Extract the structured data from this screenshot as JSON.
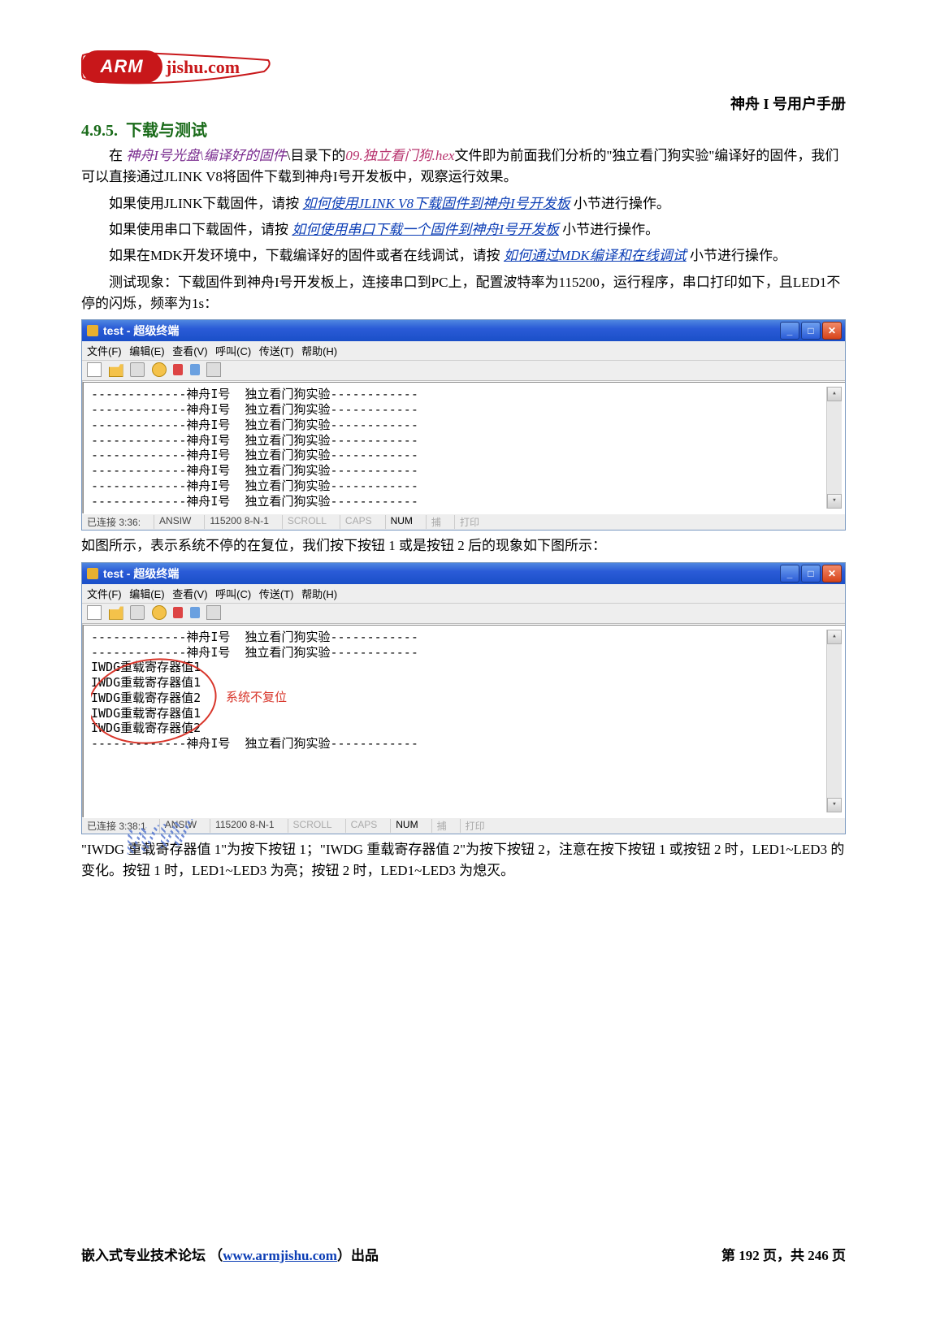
{
  "header": {
    "logo_red": "ARM",
    "logo_suffix": "jishu.com",
    "manual_title": "神舟 I 号用户手册"
  },
  "section": {
    "num": "4.9.5.",
    "title": "下载与测试"
  },
  "para": {
    "p1_a": "在 ",
    "p1_link1": "神舟I号光盘\\编译好的固件",
    "p1_b": "\\目录下的",
    "p1_link2": "09.独立看门狗.hex",
    "p1_c": "文件即为前面我们分析的\"独立看门狗实验\"编译好的固件，我们可以直接通过JLINK V8将固件下载到神舟I号开发板中，观察运行效果。",
    "p2_a": "如果使用JLINK下载固件，请按 ",
    "p2_link": "如何使用JLINK V8下载固件到神舟I号开发板",
    "p2_b": " 小节进行操作。",
    "p3_a": "如果使用串口下载固件，请按 ",
    "p3_link": "如何使用串口下载一个固件到神舟I号开发板",
    "p3_b": " 小节进行操作。",
    "p4_a": "如果在MDK开发环境中，下载编译好的固件或者在线调试，请按 ",
    "p4_link": "如何通过MDK编译和在线调试",
    "p4_b": " 小节进行操作。",
    "p5": "测试现象：下载固件到神舟I号开发板上，连接串口到PC上，配置波特率为115200，运行程序，串口打印如下，且LED1不停的闪烁，频率为1s：",
    "mid": "如图所示，表示系统不停的在复位，我们按下按钮 1 或是按钮 2 后的现象如下图所示：",
    "p6": "\"IWDG 重载寄存器值 1\"为按下按钮 1；\"IWDG 重载寄存器值 2\"为按下按钮 2，注意在按下按钮 1 或按钮 2 时，LED1~LED3 的变化。按钮 1 时，LED1~LED3 为亮；按钮 2 时，LED1~LED3 为熄灭。"
  },
  "terminal1": {
    "title": "test - 超级终端",
    "menu": {
      "file": "文件(F)",
      "edit": "编辑(E)",
      "view": "查看(V)",
      "call": "呼叫(C)",
      "transfer": "传送(T)",
      "help": "帮助(H)"
    },
    "lines": [
      "-------------神舟I号  独立看门狗实验------------",
      "-------------神舟I号  独立看门狗实验------------",
      "-------------神舟I号  独立看门狗实验------------",
      "-------------神舟I号  独立看门狗实验------------",
      "-------------神舟I号  独立看门狗实验------------",
      "-------------神舟I号  独立看门狗实验------------",
      "-------------神舟I号  独立看门狗实验------------",
      "-------------神舟I号  独立看门狗实验------------"
    ],
    "status": {
      "conn": "已连接 3:36:",
      "encoding": "ANSIW",
      "baud": "115200 8-N-1",
      "scroll": "SCROLL",
      "caps": "CAPS",
      "num": "NUM",
      "capture": "捕",
      "print": "打印"
    }
  },
  "terminal2": {
    "title": "test - 超级终端",
    "menu": {
      "file": "文件(F)",
      "edit": "编辑(E)",
      "view": "查看(V)",
      "call": "呼叫(C)",
      "transfer": "传送(T)",
      "help": "帮助(H)"
    },
    "lines": [
      "-------------神舟I号  独立看门狗实验------------",
      "-------------神舟I号  独立看门狗实验------------",
      "IWDG重载寄存器值1",
      "IWDG重载寄存器值1",
      "IWDG重载寄存器值2",
      "IWDG重载寄存器值1",
      "IWDG重载寄存器值2",
      "-------------神舟I号  独立看门狗实验------------"
    ],
    "annotation": "系统不复位",
    "status": {
      "conn": "已连接 3:38:1",
      "encoding": "ANSIW",
      "baud": "115200 8-N-1",
      "scroll": "SCROLL",
      "caps": "CAPS",
      "num": "NUM",
      "capture": "捕",
      "print": "打印"
    }
  },
  "watermark": "WW",
  "footer": {
    "left_a": "嵌入式专业技术论坛  （",
    "left_link": "www.armjishu.com",
    "left_b": "）出品",
    "right": "第 192 页，共 246 页"
  }
}
